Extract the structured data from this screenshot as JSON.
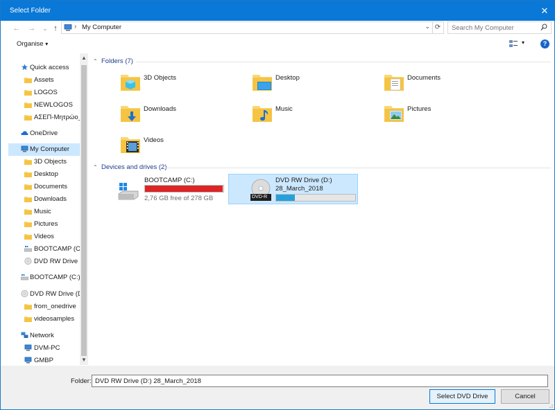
{
  "window": {
    "title": "Select Folder",
    "close_glyph": "✕"
  },
  "nav_buttons": {
    "back": "←",
    "forward": "→",
    "recent": "⌄",
    "up": "↑"
  },
  "address": {
    "crumb": "My Computer",
    "separator": "›",
    "dropdown": "⌄",
    "refresh": "⟳",
    "search_placeholder": "Search My Computer"
  },
  "toolbar": {
    "organise": "Organise",
    "organise_caret": "▾",
    "view_caret": "▾",
    "help": "?"
  },
  "sidebar": {
    "items": [
      {
        "label": "Quick access",
        "icon": "star-icon"
      },
      {
        "label": "Assets",
        "icon": "folder-icon"
      },
      {
        "label": "LOGOS",
        "icon": "folder-icon"
      },
      {
        "label": "NEWLOGOS",
        "icon": "folder-icon"
      },
      {
        "label": "ΑΣΕΠ-Μητρώο_",
        "icon": "folder-icon"
      },
      {
        "label": "OneDrive",
        "icon": "cloud-icon"
      },
      {
        "label": "My Computer",
        "icon": "computer-icon"
      },
      {
        "label": "3D Objects",
        "icon": "folder-icon"
      },
      {
        "label": "Desktop",
        "icon": "folder-icon"
      },
      {
        "label": "Documents",
        "icon": "folder-icon"
      },
      {
        "label": "Downloads",
        "icon": "folder-icon"
      },
      {
        "label": "Music",
        "icon": "folder-icon"
      },
      {
        "label": "Pictures",
        "icon": "folder-icon"
      },
      {
        "label": "Videos",
        "icon": "folder-icon"
      },
      {
        "label": "BOOTCAMP (C:)",
        "icon": "drive-icon"
      },
      {
        "label": "DVD RW Drive (D:",
        "icon": "disc-icon"
      },
      {
        "label": "BOOTCAMP (C:)",
        "icon": "drive-icon"
      },
      {
        "label": "DVD RW Drive (D:)",
        "icon": "disc-icon"
      },
      {
        "label": "from_onedrive",
        "icon": "folder-icon"
      },
      {
        "label": "videosamples",
        "icon": "folder-icon"
      },
      {
        "label": "Network",
        "icon": "network-icon"
      },
      {
        "label": "DVM-PC",
        "icon": "computer-icon"
      },
      {
        "label": "GMBP",
        "icon": "computer-icon"
      }
    ],
    "scroll_up": "▲",
    "scroll_down": "▼"
  },
  "folders_group": {
    "header": "Folders (7)",
    "chevron": "⌃",
    "items": [
      "3D Objects",
      "Desktop",
      "Documents",
      "Downloads",
      "Music",
      "Pictures",
      "Videos"
    ]
  },
  "drives_group": {
    "header": "Devices and drives (2)",
    "chevron": "⌃",
    "drives": [
      {
        "name": "BOOTCAMP (C:)",
        "free_text": "2,76 GB free of 278 GB",
        "used_fraction": 0.99,
        "bar_color": "#da2626"
      },
      {
        "name": "DVD RW Drive (D:)",
        "volume": "28_March_2018",
        "disc_label": "DVD-R",
        "used_fraction": 0.24,
        "bar_color": "#26a0da"
      }
    ]
  },
  "footer": {
    "folder_label": "Folder:",
    "folder_value": "DVD RW Drive (D:) 28_March_2018",
    "select_button": "Select DVD Drive",
    "cancel_button": "Cancel"
  },
  "colors": {
    "titlebar": "#0a78d7",
    "folder_yellow": "#f8d775",
    "selection": "#cce8ff",
    "header_blue": "#1e3b8b"
  }
}
